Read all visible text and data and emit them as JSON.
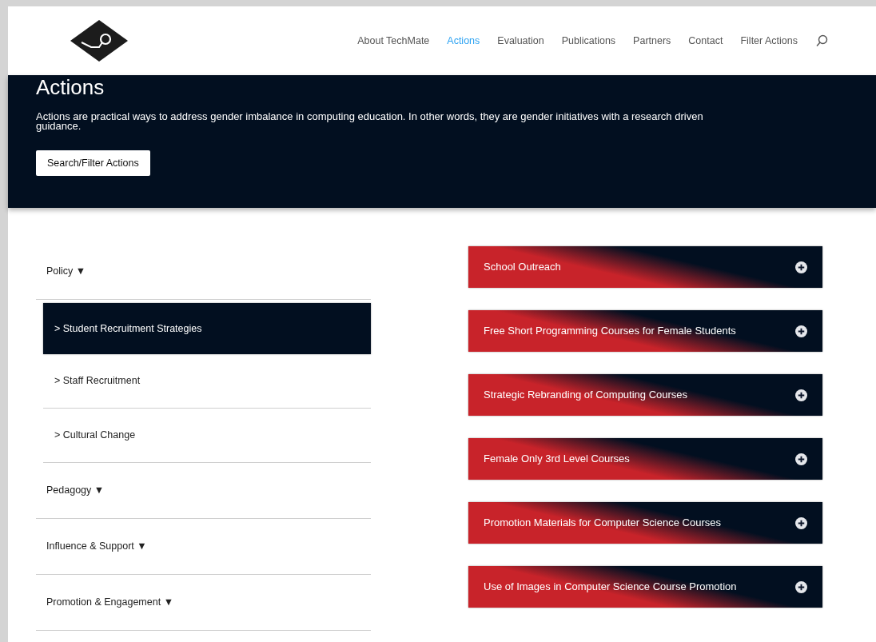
{
  "header": {
    "nav": [
      {
        "label": "About TechMate",
        "selected": false
      },
      {
        "label": "Actions",
        "selected": true
      },
      {
        "label": "Evaluation",
        "selected": false
      },
      {
        "label": "Publications",
        "selected": false
      },
      {
        "label": "Partners",
        "selected": false
      },
      {
        "label": "Contact",
        "selected": false
      },
      {
        "label": "Filter Actions",
        "selected": false
      }
    ]
  },
  "banner": {
    "title": "Actions",
    "description": "Actions are practical ways to address gender imbalance in computing education. In other words, they are gender initiatives with a research driven guidance.",
    "button": "Search/Filter Actions"
  },
  "sidebar": {
    "items": [
      {
        "label": "Policy",
        "toggle": "▼",
        "children": [
          {
            "label": "> Student Recruitment Strategies",
            "selected": true
          },
          {
            "label": "> Staff Recruitment",
            "selected": false
          },
          {
            "label": "> Cultural Change",
            "selected": false
          }
        ]
      },
      {
        "label": "Pedagogy",
        "toggle": "▼"
      },
      {
        "label": "Influence & Support",
        "toggle": "▼"
      },
      {
        "label": "Promotion & Engagement",
        "toggle": "▼"
      }
    ]
  },
  "actions": [
    {
      "title": "School Outreach"
    },
    {
      "title": "Free Short Programming Courses for Female Students"
    },
    {
      "title": "Strategic Rebranding of Computing Courses"
    },
    {
      "title": "Female Only 3rd Level Courses"
    },
    {
      "title": "Promotion Materials for Computer Science Courses"
    },
    {
      "title": "Use of Images in Computer Science Course Promotion"
    }
  ]
}
